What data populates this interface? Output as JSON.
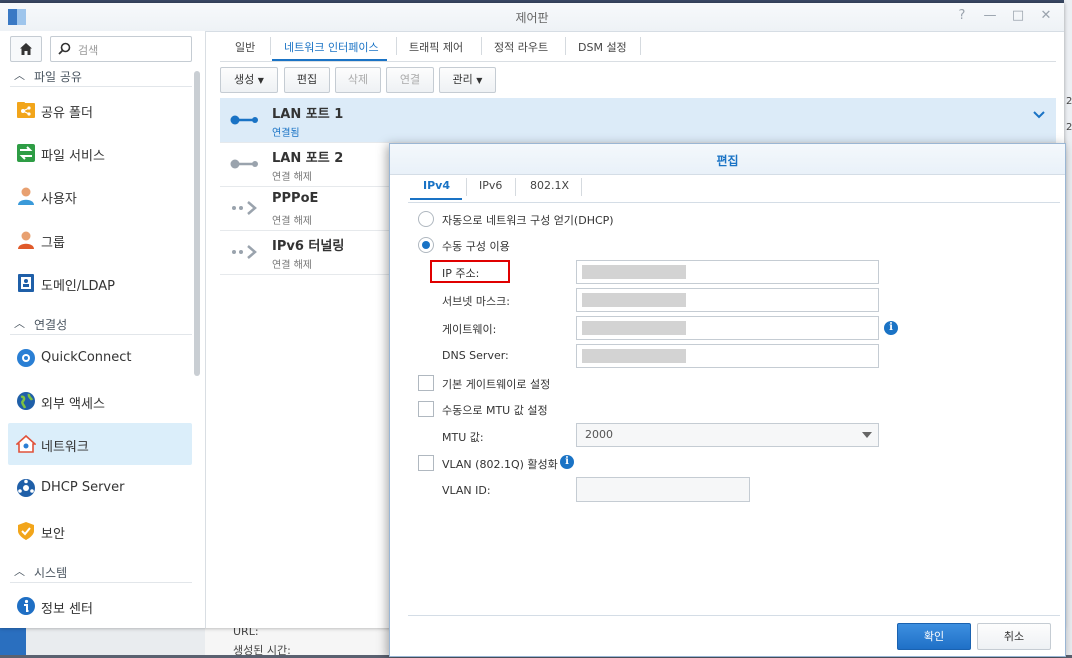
{
  "window": {
    "title": "제어판",
    "controls": [
      "?",
      "—",
      "□",
      "✕"
    ]
  },
  "sidebar": {
    "search_placeholder": "검색",
    "sections": [
      {
        "label": "파일 공유",
        "items": [
          {
            "label": "공유 폴더",
            "icon": "shared-folder-icon"
          },
          {
            "label": "파일 서비스",
            "icon": "file-services-icon"
          },
          {
            "label": "사용자",
            "icon": "user-icon"
          },
          {
            "label": "그룹",
            "icon": "group-icon"
          },
          {
            "label": "도메인/LDAP",
            "icon": "domain-ldap-icon"
          }
        ]
      },
      {
        "label": "연결성",
        "items": [
          {
            "label": "QuickConnect",
            "icon": "quickconnect-icon"
          },
          {
            "label": "외부 액세스",
            "icon": "external-access-icon"
          },
          {
            "label": "네트워크",
            "icon": "network-icon",
            "active": true
          },
          {
            "label": "DHCP Server",
            "icon": "dhcp-server-icon"
          },
          {
            "label": "보안",
            "icon": "security-shield-icon"
          }
        ]
      },
      {
        "label": "시스템",
        "items": [
          {
            "label": "정보 센터",
            "icon": "info-center-icon"
          }
        ]
      }
    ]
  },
  "tabs": [
    "일반",
    "네트워크 인터페이스",
    "트래픽 제어",
    "정적 라우트",
    "DSM 설정"
  ],
  "active_tab": "네트워크 인터페이스",
  "toolbar": {
    "create": "생성",
    "edit": "편집",
    "delete": "삭제",
    "connect": "연결",
    "manage": "관리"
  },
  "interfaces": [
    {
      "name": "LAN 포트 1",
      "status": "연결됨"
    },
    {
      "name": "LAN 포트 2",
      "status": "연결 해제"
    },
    {
      "name": "PPPoE",
      "status": "연결 해제"
    },
    {
      "name": "IPv6 터널링",
      "status": "연결 해제"
    }
  ],
  "background": {
    "right_text": [
      "2,",
      "2,"
    ],
    "bottom_labels": [
      "URL:",
      "생성된 시간:"
    ]
  },
  "dialog": {
    "title": "편집",
    "tabs": [
      "IPv4",
      "IPv6",
      "802.1X"
    ],
    "active_tab": "IPv4",
    "dhcp_option": "자동으로 네트워크 구성 얻기(DHCP)",
    "manual_option": "수동 구성 이용",
    "ip_label": "IP 주소:",
    "subnet_label": "서브넷 마스크:",
    "gateway_label": "게이트웨이:",
    "dns_label": "DNS Server:",
    "default_gateway_check": "기본 게이트웨이로 설정",
    "mtu_check": "수동으로 MTU 값 설정",
    "mtu_label": "MTU 값:",
    "mtu_value": "2000",
    "vlan_check": "VLAN (802.1Q) 활성화",
    "vlan_id_label": "VLAN ID:",
    "ok": "확인",
    "cancel": "취소"
  }
}
